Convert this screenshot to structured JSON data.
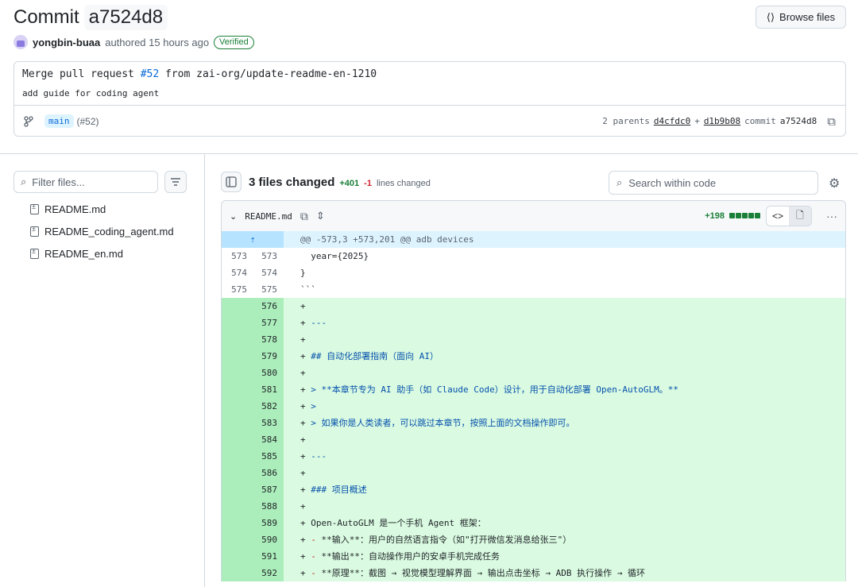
{
  "header": {
    "title_prefix": "Commit",
    "sha": "a7524d8",
    "browse_label": "Browse files",
    "author": "yongbin-buaa",
    "authored": "authored 15 hours ago",
    "verified": "Verified"
  },
  "message": {
    "pre": "Merge pull request ",
    "pr": "#52",
    "post": " from zai-org/update-readme-en-1210",
    "body": "add guide for coding agent",
    "branch": "main",
    "pr_ref": "(#52)",
    "parents_label": "2 parents",
    "parent1": "d4cfdc0",
    "plus": "+",
    "parent2": "d1b9b08",
    "commit_label": "commit",
    "commit_sha": "a7524d8"
  },
  "sidebar": {
    "filter_placeholder": "Filter files...",
    "files": [
      "README.md",
      "README_coding_agent.md",
      "README_en.md"
    ]
  },
  "toolbar": {
    "files_changed": "3 files changed",
    "additions": "+401",
    "deletions": "-1",
    "lines_changed": "lines changed",
    "search_placeholder": "Search within code"
  },
  "file": {
    "name": "README.md",
    "additions": "+198",
    "hunk": "@@ -573,3 +573,201 @@ adb devices"
  },
  "lines": [
    {
      "old": "573",
      "new": "573",
      "type": "ctx",
      "segs": [
        [
          "k",
          "  year={2025}"
        ]
      ]
    },
    {
      "old": "574",
      "new": "574",
      "type": "ctx",
      "segs": [
        [
          "k",
          "}"
        ]
      ]
    },
    {
      "old": "575",
      "new": "575",
      "type": "ctx",
      "segs": [
        [
          "k",
          "```"
        ]
      ]
    },
    {
      "old": "",
      "new": "576",
      "type": "add",
      "segs": [
        [
          "k",
          "+"
        ]
      ]
    },
    {
      "old": "",
      "new": "577",
      "type": "add",
      "segs": [
        [
          "k",
          "+ "
        ],
        [
          "b",
          "---"
        ]
      ]
    },
    {
      "old": "",
      "new": "578",
      "type": "add",
      "segs": [
        [
          "k",
          "+"
        ]
      ]
    },
    {
      "old": "",
      "new": "579",
      "type": "add",
      "segs": [
        [
          "k",
          "+ "
        ],
        [
          "b",
          "## 自动化部署指南（面向 AI）"
        ]
      ]
    },
    {
      "old": "",
      "new": "580",
      "type": "add",
      "segs": [
        [
          "k",
          "+"
        ]
      ]
    },
    {
      "old": "",
      "new": "581",
      "type": "add",
      "segs": [
        [
          "k",
          "+ "
        ],
        [
          "b",
          "> **本章节专为 AI 助手（如 Claude Code）设计，用于自动化部署 Open-AutoGLM。**"
        ]
      ]
    },
    {
      "old": "",
      "new": "582",
      "type": "add",
      "segs": [
        [
          "k",
          "+ "
        ],
        [
          "b",
          ">"
        ]
      ]
    },
    {
      "old": "",
      "new": "583",
      "type": "add",
      "segs": [
        [
          "k",
          "+ "
        ],
        [
          "b",
          "> 如果你是人类读者，可以跳过本章节，按照上面的文档操作即可。"
        ]
      ]
    },
    {
      "old": "",
      "new": "584",
      "type": "add",
      "segs": [
        [
          "k",
          "+"
        ]
      ]
    },
    {
      "old": "",
      "new": "585",
      "type": "add",
      "segs": [
        [
          "k",
          "+ "
        ],
        [
          "b",
          "---"
        ]
      ]
    },
    {
      "old": "",
      "new": "586",
      "type": "add",
      "segs": [
        [
          "k",
          "+"
        ]
      ]
    },
    {
      "old": "",
      "new": "587",
      "type": "add",
      "segs": [
        [
          "k",
          "+ "
        ],
        [
          "b",
          "### 项目概述"
        ]
      ]
    },
    {
      "old": "",
      "new": "588",
      "type": "add",
      "segs": [
        [
          "k",
          "+"
        ]
      ]
    },
    {
      "old": "",
      "new": "589",
      "type": "add",
      "segs": [
        [
          "k",
          "+ Open-AutoGLM 是一个手机 Agent 框架："
        ]
      ]
    },
    {
      "old": "",
      "new": "590",
      "type": "add",
      "segs": [
        [
          "k",
          "+ "
        ],
        [
          "r",
          "-"
        ],
        [
          "k",
          " **输入**：用户的自然语言指令（如\"打开微信发消息给张三\"）"
        ]
      ]
    },
    {
      "old": "",
      "new": "591",
      "type": "add",
      "segs": [
        [
          "k",
          "+ "
        ],
        [
          "r",
          "-"
        ],
        [
          "k",
          " **输出**：自动操作用户的安卓手机完成任务"
        ]
      ]
    },
    {
      "old": "",
      "new": "592",
      "type": "add",
      "segs": [
        [
          "k",
          "+ "
        ],
        [
          "r",
          "-"
        ],
        [
          "k",
          " **原理**：截图 → 视觉模型理解界面 → 输出点击坐标 → ADB 执行操作 → 循环"
        ]
      ]
    }
  ]
}
